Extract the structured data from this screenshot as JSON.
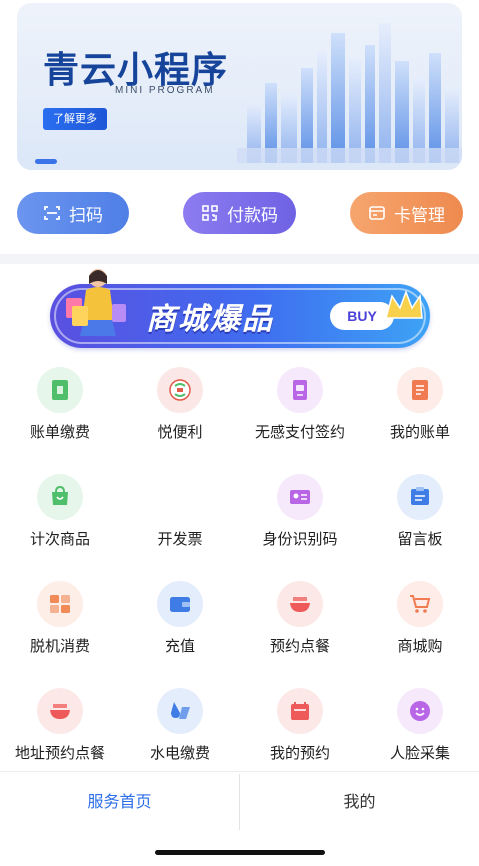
{
  "banner": {
    "title": "青云小程序",
    "subtitle": "MINI PROGRAM",
    "more_label": "了解更多"
  },
  "quick_actions": [
    {
      "label": "扫码",
      "icon": "scan-icon",
      "color": "#5a88ea"
    },
    {
      "label": "付款码",
      "icon": "qrcode-icon",
      "color": "#7d6eea"
    },
    {
      "label": "卡管理",
      "icon": "card-icon",
      "color": "#f19a5f"
    }
  ],
  "mall_banner": {
    "title": "商城爆品",
    "buy_label": "BUY"
  },
  "services": [
    {
      "label": "账单缴费",
      "icon": "bill-icon",
      "color": "#4fbf6b"
    },
    {
      "label": "悦便利",
      "icon": "yue-convenience-icon",
      "color": "#e35b4b"
    },
    {
      "label": "无感支付签约",
      "icon": "contactless-sign-icon",
      "color": "#b865e6"
    },
    {
      "label": "我的账单",
      "icon": "my-bill-icon",
      "color": "#f07a52"
    },
    {
      "label": "计次商品",
      "icon": "count-goods-icon",
      "color": "#4fbf6b"
    },
    {
      "label": "开发票",
      "icon": "",
      "color": ""
    },
    {
      "label": "身份识别码",
      "icon": "id-code-icon",
      "color": "#b865e6"
    },
    {
      "label": "留言板",
      "icon": "message-board-icon",
      "color": "#3f7ce6"
    },
    {
      "label": "脱机消费",
      "icon": "offline-pay-icon",
      "color": "#f08a57"
    },
    {
      "label": "充值",
      "icon": "wallet-icon",
      "color": "#3f7ce6"
    },
    {
      "label": "预约点餐",
      "icon": "bowl-icon",
      "color": "#ee5a5a"
    },
    {
      "label": "商城购",
      "icon": "cart-icon",
      "color": "#f07a52"
    },
    {
      "label": "地址预约点餐",
      "icon": "bowl-icon",
      "color": "#ee5a5a"
    },
    {
      "label": "水电缴费",
      "icon": "water-electric-icon",
      "color": "#3f7ce6"
    },
    {
      "label": "我的预约",
      "icon": "reservation-icon",
      "color": "#ee5a5a"
    },
    {
      "label": "人脸采集",
      "icon": "face-icon",
      "color": "#b865e6"
    }
  ],
  "tabbar": {
    "home_label": "服务首页",
    "mine_label": "我的",
    "active_color": "#2c6ee8"
  }
}
